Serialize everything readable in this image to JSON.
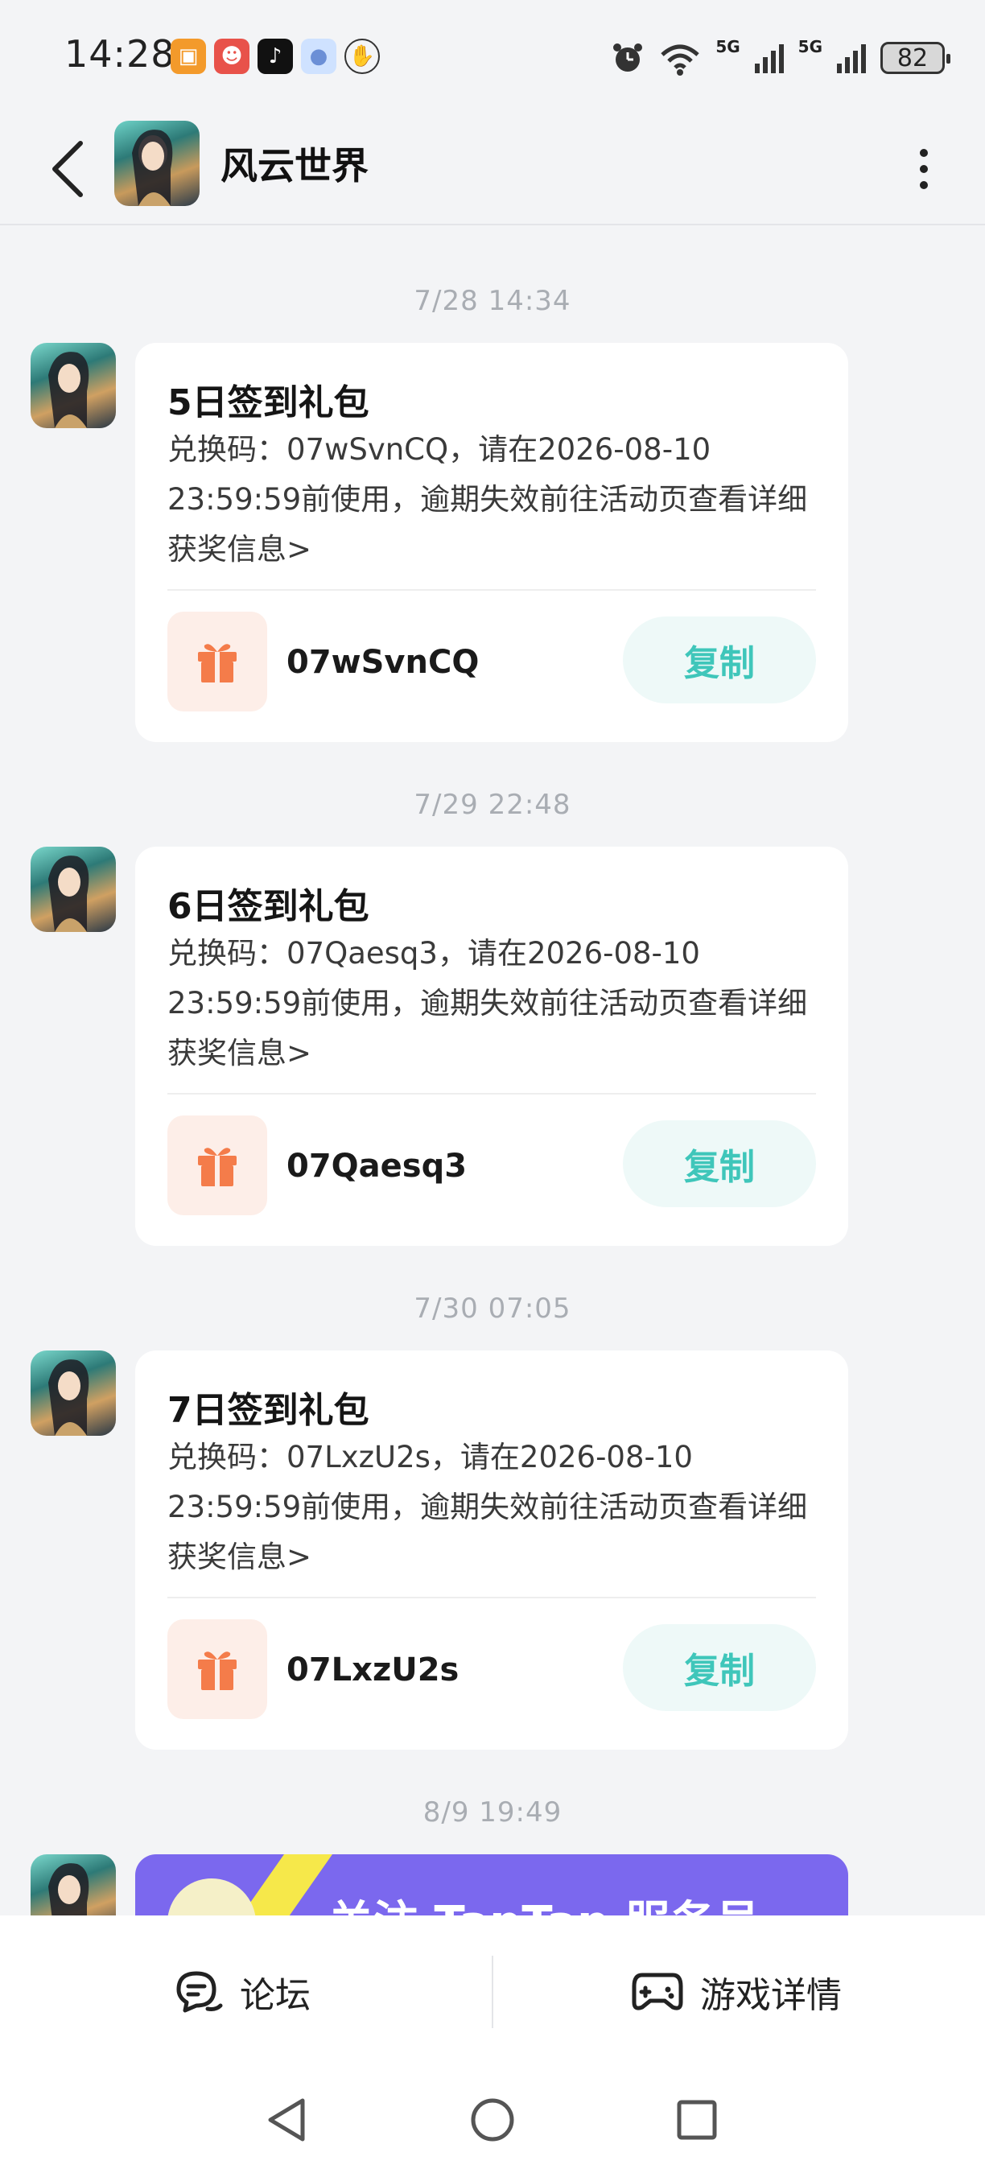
{
  "status_bar": {
    "time": "14:28",
    "signal_label_1": "5G",
    "signal_label_2": "5G",
    "battery": "82",
    "icons": [
      "app-icon-orange",
      "app-icon-clown",
      "tiktok-icon",
      "chat-bot-icon",
      "shield-hand-icon",
      "alarm-icon",
      "wifi-icon",
      "signal-icon"
    ]
  },
  "header": {
    "title": "风云世界",
    "back_icon": "chevron-left-icon",
    "more_icon": "more-vertical-icon"
  },
  "messages": [
    {
      "timestamp": "7/28  14:34",
      "title": "5日签到礼包",
      "body": "兑换码：07wSvnCQ，请在2026-08-10 23:59:59前使用，逾期失效前往活动页查看详细获奖信息>",
      "code": "07wSvnCQ",
      "copy_label": "复制"
    },
    {
      "timestamp": "7/29  22:48",
      "title": "6日签到礼包",
      "body": "兑换码：07Qaesq3，请在2026-08-10 23:59:59前使用，逾期失效前往活动页查看详细获奖信息>",
      "code": "07Qaesq3",
      "copy_label": "复制"
    },
    {
      "timestamp": "7/30  07:05",
      "title": "7日签到礼包",
      "body": "兑换码：07LxzU2s，请在2026-08-10 23:59:59前使用，逾期失效前往活动页查看详细获奖信息>",
      "code": "07LxzU2s",
      "copy_label": "复制"
    }
  ],
  "last_message": {
    "timestamp": "8/9  19:49",
    "banner_text": "关注 TapTap 服务号"
  },
  "bottom_bar": {
    "forum_label": "论坛",
    "detail_label": "游戏详情"
  },
  "colors": {
    "accent": "#3fc6ba",
    "copy_bg": "#eef9f8",
    "gift": "#f47c4a",
    "gift_bg": "#fdeee8",
    "promo": "#7b68ee"
  }
}
